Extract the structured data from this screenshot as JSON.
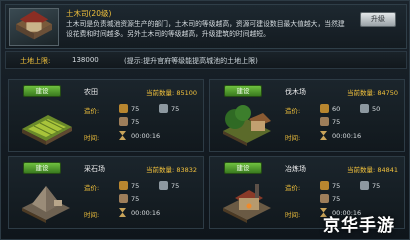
{
  "header": {
    "title": "土木司(20级)",
    "description": "土木司是负责城池资源生产的部门，土木司的等级越高，资源可建设数目最大值越大，当然建设花费和时间越多。另外土木司的等级越高，升级建筑的时间越短。",
    "upgrade_label": "升级"
  },
  "land": {
    "label": "土地上限:",
    "value": "138000",
    "hint": "(提示:提升官府等级能提高城池的土地上限)"
  },
  "cards": [
    {
      "build_label": "建设",
      "name": "农田",
      "count_label": "当前数量:",
      "count": "85100",
      "cost_label": "造价:",
      "time_label": "时间:",
      "cost": [
        "75",
        "75",
        "75"
      ],
      "time": "00:00:16",
      "resource_icons": [
        "wood-icon",
        "iron-icon",
        "stone-icon"
      ],
      "thumb": "farm"
    },
    {
      "build_label": "建设",
      "name": "伐木场",
      "count_label": "当前数量:",
      "count": "84750",
      "cost_label": "造价:",
      "time_label": "时间:",
      "cost": [
        "60",
        "50",
        "75"
      ],
      "time": "00:00:16",
      "resource_icons": [
        "wood-icon",
        "iron-icon",
        "stone-icon"
      ],
      "thumb": "lumber"
    },
    {
      "build_label": "建设",
      "name": "采石场",
      "count_label": "当前数量:",
      "count": "83832",
      "cost_label": "造价:",
      "time_label": "时间:",
      "cost": [
        "75",
        "75",
        "75"
      ],
      "time": "00:00:16",
      "resource_icons": [
        "wood-icon",
        "iron-icon",
        "stone-icon"
      ],
      "thumb": "quarry"
    },
    {
      "build_label": "建设",
      "name": "冶炼场",
      "count_label": "当前数量:",
      "count": "84841",
      "cost_label": "造价:",
      "time_label": "时间:",
      "cost": [
        "75",
        "75",
        "75"
      ],
      "time": "00:00:16",
      "resource_icons": [
        "wood-icon",
        "iron-icon",
        "stone-icon"
      ],
      "thumb": "smelter"
    }
  ],
  "watermark": "京华手游",
  "colors": {
    "accent_gold": "#f2c23c",
    "build_green": "#5aa832",
    "wood": "#b8862f",
    "iron": "#8d98a0",
    "stone": "#9e7e5a"
  }
}
